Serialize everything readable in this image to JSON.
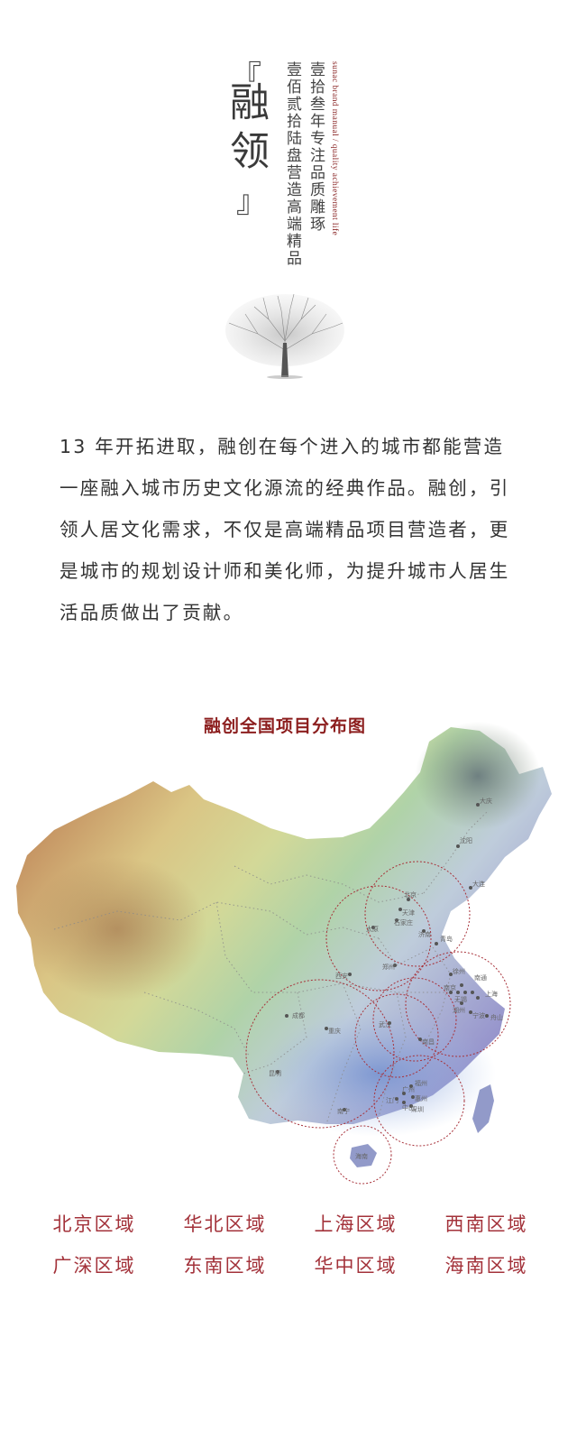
{
  "header": {
    "bracket_open": "『",
    "bracket_close": "』",
    "title": "融领",
    "line_1": "壹拾叁年专注品质雕琢",
    "line_2": "壹佰贰拾陆盘营造高端精品",
    "english": "sunac brand manual / quality achievement life"
  },
  "intro": {
    "text": "13 年开拓进取，融创在每个进入的城市都能营造一座融入城市历史文化源流的经典作品。融创，引领人居文化需求，不仅是高端精品项目营造者，更是城市的规划设计师和美化师，为提升城市人居生活品质做出了贡献。"
  },
  "map": {
    "title": "融创全国项目分布图",
    "dot_color": "#555555",
    "circle_color": "#a8323a"
  },
  "regions": [
    "北京区域",
    "华北区域",
    "上海区域",
    "西南区域",
    "广深区域",
    "东南区域",
    "华中区域",
    "海南区域"
  ]
}
